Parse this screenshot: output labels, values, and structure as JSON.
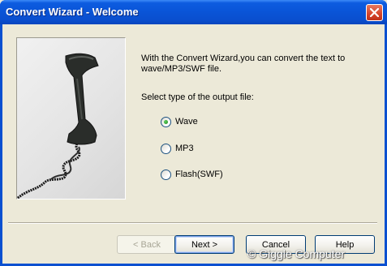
{
  "window": {
    "title": "Convert Wizard - Welcome",
    "close_icon": "close-icon"
  },
  "main": {
    "image_icon": "telephone-handset-image",
    "description": "With the Convert Wizard,you can convert the text to\nwave/MP3/SWF file.",
    "group_label": "Select type of the output file:",
    "options": [
      {
        "label": "Wave",
        "checked": true
      },
      {
        "label": "MP3",
        "checked": false
      },
      {
        "label": "Flash(SWF)",
        "checked": false
      }
    ]
  },
  "buttons": {
    "back": "< Back",
    "next": "Next >",
    "cancel": "Cancel",
    "help": "Help"
  },
  "watermark": "© Giggle Computer",
  "colors": {
    "titlebar": "#0a55d8",
    "dialog_bg": "#ece9d8",
    "close_button": "#d6442a",
    "radio_dot": "#1f8a1f"
  }
}
